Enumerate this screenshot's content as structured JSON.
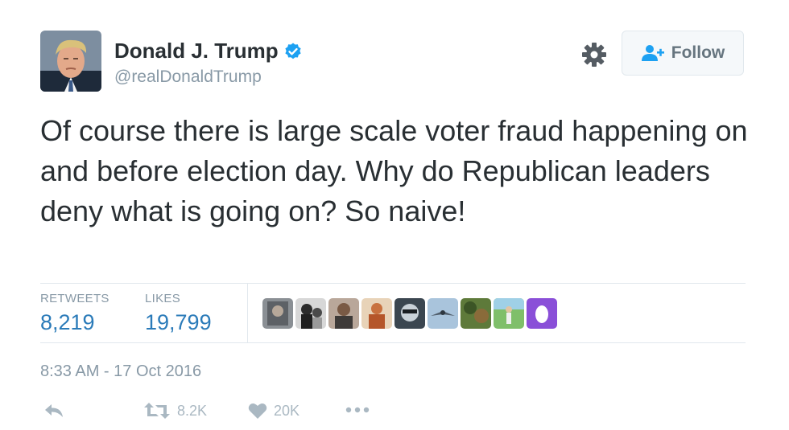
{
  "user": {
    "name": "Donald J. Trump",
    "handle": "@realDonaldTrump",
    "avatar_icon": "profile-photo",
    "verified_icon": "verified-badge-icon"
  },
  "header": {
    "settings_icon": "gear-icon",
    "follow_label": "Follow",
    "follow_icon": "add-user-icon"
  },
  "tweet": {
    "text": "Of course there is large scale voter fraud happening on and before election day. Why do Republican leaders deny what is going on? So naive!"
  },
  "stats": {
    "retweets_label": "RETWEETS",
    "retweets_value": "8,219",
    "likes_label": "LIKES",
    "likes_value": "19,799"
  },
  "likers": [
    {
      "icon": "liker-avatar-1"
    },
    {
      "icon": "liker-avatar-2"
    },
    {
      "icon": "liker-avatar-3"
    },
    {
      "icon": "liker-avatar-4"
    },
    {
      "icon": "liker-avatar-5"
    },
    {
      "icon": "liker-avatar-6"
    },
    {
      "icon": "liker-avatar-7"
    },
    {
      "icon": "liker-avatar-8"
    },
    {
      "icon": "egg-avatar-icon"
    }
  ],
  "timestamp": "8:33 AM - 17 Oct 2016",
  "actions": {
    "reply_icon": "reply-icon",
    "retweet_icon": "retweet-icon",
    "retweet_count": "8.2K",
    "like_icon": "heart-icon",
    "like_count": "20K",
    "more_icon": "more-dots-icon"
  },
  "colors": {
    "text": "#292f33",
    "muted": "#8899a6",
    "link_blue": "#2b7bb9",
    "verified_blue": "#1da1f2",
    "action_gray": "#aab8c2"
  }
}
